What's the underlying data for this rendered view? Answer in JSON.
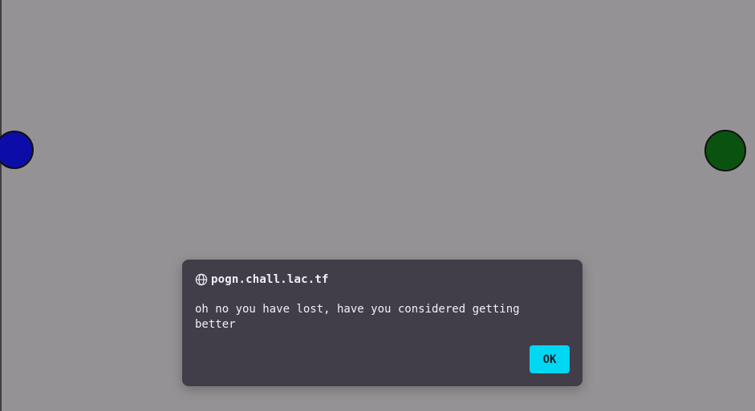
{
  "game": {
    "player_ball_color": "#0c0ca8",
    "opponent_ball_color": "#0a5210",
    "background_color": "#949294"
  },
  "dialog": {
    "origin": "pogn.chall.lac.tf",
    "origin_icon": "globe-icon",
    "message": "oh no you have lost, have you considered getting better",
    "ok_label": "OK",
    "ok_color": "#00d7f3",
    "background_color": "#413e49"
  }
}
